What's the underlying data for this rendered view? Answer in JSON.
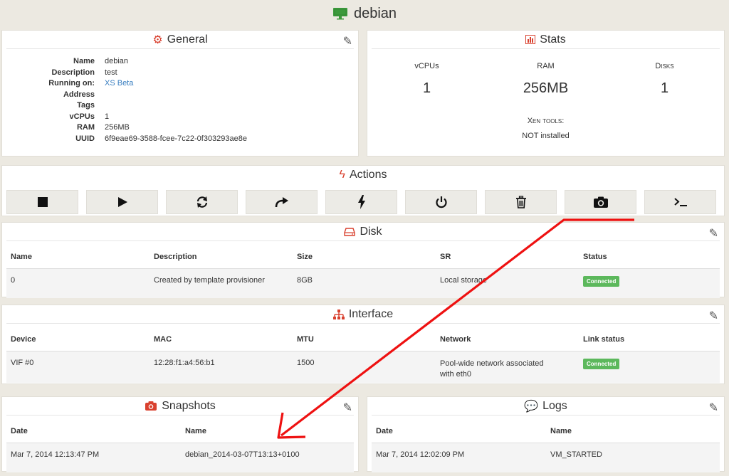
{
  "page": {
    "title": "debian"
  },
  "general": {
    "title": "General",
    "fields": [
      {
        "label": "Name",
        "value": "debian"
      },
      {
        "label": "Description",
        "value": "test"
      },
      {
        "label": "Running on:",
        "value": "XS Beta"
      },
      {
        "label": "Address",
        "value": ""
      },
      {
        "label": "Tags",
        "value": ""
      },
      {
        "label": "vCPUs",
        "value": "1"
      },
      {
        "label": "RAM",
        "value": "256MB"
      },
      {
        "label": "UUID",
        "value": "6f9eae69-3588-fcee-7c22-0f303293ae8e"
      }
    ]
  },
  "stats": {
    "title": "Stats",
    "vcpus_label": "vCPUs",
    "vcpus_value": "1",
    "ram_label": "RAM",
    "ram_value": "256MB",
    "disks_label": "Disks",
    "disks_value": "1",
    "xen_label": "Xen tools:",
    "xen_value": "NOT installed"
  },
  "actions": {
    "title": "Actions",
    "buttons": [
      "stop-icon",
      "play-icon",
      "refresh-icon",
      "migrate-icon",
      "bolt-icon",
      "power-icon",
      "trash-icon",
      "camera-icon",
      "terminal-icon"
    ]
  },
  "disk": {
    "title": "Disk",
    "headers": [
      "Name",
      "Description",
      "Size",
      "SR",
      "Status"
    ],
    "rows": [
      [
        "0",
        "Created by template provisioner",
        "8GB",
        "Local storage",
        "Connected"
      ]
    ]
  },
  "interface": {
    "title": "Interface",
    "headers": [
      "Device",
      "MAC",
      "MTU",
      "Network",
      "Link status"
    ],
    "rows": [
      [
        "VIF #0",
        "12:28:f1:a4:56:b1",
        "1500",
        "Pool-wide network associated with eth0",
        "Connected"
      ]
    ]
  },
  "snapshots": {
    "title": "Snapshots",
    "headers": [
      "Date",
      "Name"
    ],
    "rows": [
      [
        "Mar 7, 2014 12:13:47 PM",
        "debian_2014-03-07T13:13+0100"
      ]
    ]
  },
  "logs": {
    "title": "Logs",
    "headers": [
      "Date",
      "Name"
    ],
    "rows": [
      [
        "Mar 7, 2014 12:02:09 PM",
        "VM_STARTED"
      ]
    ]
  },
  "colors": {
    "accent_red": "#d9412f",
    "success_green": "#5cb85c",
    "link_blue": "#3a7fc1",
    "annotation_red": "#ee1111"
  }
}
